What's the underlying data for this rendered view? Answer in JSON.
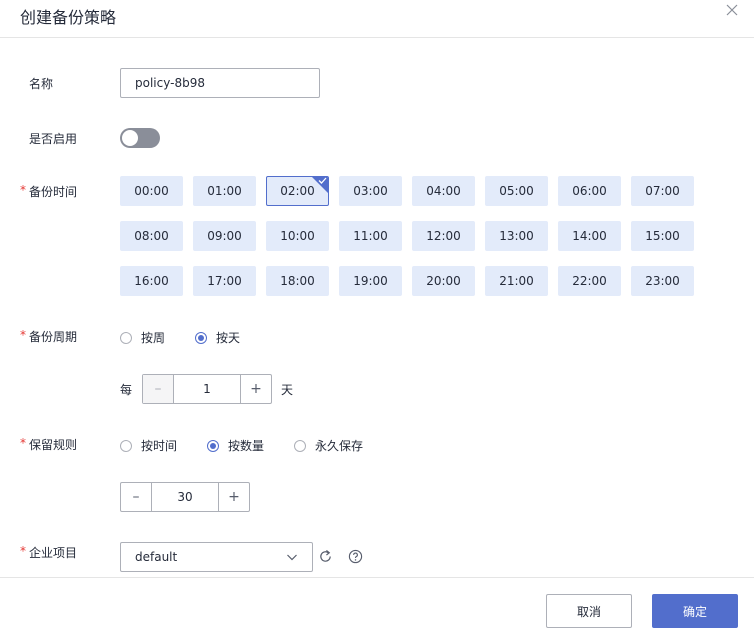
{
  "dialog": {
    "title": "创建备份策略"
  },
  "form": {
    "name": {
      "label": "名称",
      "value": "policy-8b98"
    },
    "enabled": {
      "label": "是否启用",
      "on": false
    },
    "backup_time": {
      "label": "备份时间",
      "slots": [
        "00:00",
        "01:00",
        "02:00",
        "03:00",
        "04:00",
        "05:00",
        "06:00",
        "07:00",
        "08:00",
        "09:00",
        "10:00",
        "11:00",
        "12:00",
        "13:00",
        "14:00",
        "15:00",
        "16:00",
        "17:00",
        "18:00",
        "19:00",
        "20:00",
        "21:00",
        "22:00",
        "23:00"
      ],
      "selected": "02:00"
    },
    "backup_cycle": {
      "label": "备份周期",
      "options": [
        "按周",
        "按天"
      ],
      "selected": "按天",
      "prefix": "每",
      "value": "1",
      "suffix": "天",
      "minus": "–",
      "plus": "+"
    },
    "retention": {
      "label": "保留规则",
      "options": [
        "按时间",
        "按数量",
        "永久保存"
      ],
      "selected": "按数量",
      "value": "30",
      "minus": "–",
      "plus": "+"
    },
    "enterprise_project": {
      "label": "企业项目",
      "value": "default"
    }
  },
  "footer": {
    "cancel_label": "取消",
    "confirm_label": "确定"
  },
  "colors": {
    "accent": "#526ecc",
    "slot_bg": "#e3ebfa",
    "required": "#e53935"
  }
}
